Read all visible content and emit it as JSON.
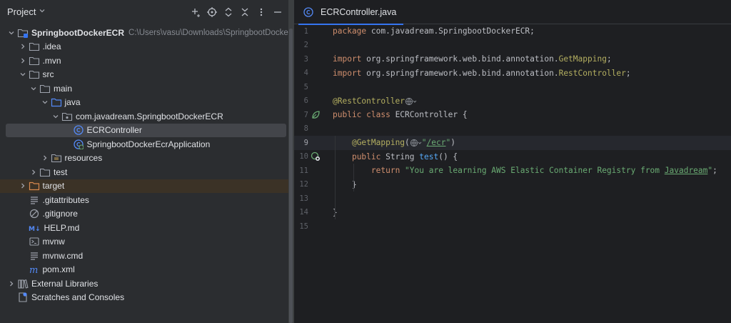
{
  "project_panel": {
    "title": "Project",
    "tools": [
      "add-icon",
      "target-icon",
      "expand-all-icon",
      "collapse-all-icon",
      "more-icon",
      "hide-icon"
    ],
    "tree": [
      {
        "depth": 0,
        "arrow": "down",
        "icon": "module-icon",
        "label": "SpringbootDockerECR",
        "hint": "C:\\Users\\vasu\\Downloads\\SpringbootDockerECR",
        "bold": true
      },
      {
        "depth": 1,
        "arrow": "right",
        "icon": "folder-icon",
        "label": ".idea"
      },
      {
        "depth": 1,
        "arrow": "right",
        "icon": "folder-icon",
        "label": ".mvn"
      },
      {
        "depth": 1,
        "arrow": "down",
        "icon": "folder-icon",
        "label": "src"
      },
      {
        "depth": 2,
        "arrow": "down",
        "icon": "folder-icon",
        "label": "main"
      },
      {
        "depth": 3,
        "arrow": "down",
        "icon": "source-folder-icon",
        "label": "java"
      },
      {
        "depth": 4,
        "arrow": "down",
        "icon": "package-icon",
        "label": "com.javadream.SpringbootDockerECR"
      },
      {
        "depth": 5,
        "arrow": "none",
        "icon": "class-icon",
        "label": "ECRController",
        "selected": true
      },
      {
        "depth": 5,
        "arrow": "none",
        "icon": "spring-class-icon",
        "label": "SpringbootDockerEcrApplication"
      },
      {
        "depth": 3,
        "arrow": "right",
        "icon": "resources-folder-icon",
        "label": "resources"
      },
      {
        "depth": 2,
        "arrow": "right",
        "icon": "folder-icon",
        "label": "test"
      },
      {
        "depth": 1,
        "arrow": "right",
        "icon": "excluded-folder-icon",
        "label": "target",
        "excluded": true
      },
      {
        "depth": 1,
        "arrow": "none",
        "icon": "text-file-icon",
        "label": ".gitattributes"
      },
      {
        "depth": 1,
        "arrow": "none",
        "icon": "ignore-file-icon",
        "label": ".gitignore"
      },
      {
        "depth": 1,
        "arrow": "none",
        "icon": "markdown-icon",
        "label": "HELP.md"
      },
      {
        "depth": 1,
        "arrow": "none",
        "icon": "shell-script-icon",
        "label": "mvnw"
      },
      {
        "depth": 1,
        "arrow": "none",
        "icon": "text-file-icon",
        "label": "mvnw.cmd"
      },
      {
        "depth": 1,
        "arrow": "none",
        "icon": "maven-icon",
        "label": "pom.xml"
      },
      {
        "depth": 0,
        "arrow": "right",
        "icon": "library-icon",
        "label": "External Libraries"
      },
      {
        "depth": 0,
        "arrow": "none",
        "icon": "scratches-icon",
        "label": "Scratches and Consoles"
      }
    ]
  },
  "editor": {
    "tab": {
      "label": "ECRController.java",
      "icon": "class-icon"
    },
    "current_line": 9,
    "lines": [
      {
        "n": "1",
        "tokens": [
          {
            "t": "package ",
            "c": "kw"
          },
          {
            "t": "com.javadream.SpringbootDockerECR;",
            "c": ""
          }
        ]
      },
      {
        "n": "2",
        "tokens": []
      },
      {
        "n": "3",
        "tokens": [
          {
            "t": "import ",
            "c": "kw"
          },
          {
            "t": "org.springframework.web.bind.annotation.",
            "c": ""
          },
          {
            "t": "GetMapping",
            "c": "ann"
          },
          {
            "t": ";",
            "c": ""
          }
        ]
      },
      {
        "n": "4",
        "tokens": [
          {
            "t": "import ",
            "c": "kw"
          },
          {
            "t": "org.springframework.web.bind.annotation.",
            "c": ""
          },
          {
            "t": "RestController",
            "c": "ann"
          },
          {
            "t": ";",
            "c": ""
          }
        ]
      },
      {
        "n": "5",
        "tokens": []
      },
      {
        "n": "6",
        "tokens": [
          {
            "t": "@RestController",
            "c": "ann"
          },
          {
            "t": "",
            "c": "inlay-globe"
          }
        ]
      },
      {
        "n": "7",
        "gutter": "spring-bean-icon",
        "tokens": [
          {
            "t": "public class ",
            "c": "kw"
          },
          {
            "t": "ECRController {",
            "c": ""
          }
        ]
      },
      {
        "n": "8",
        "tokens": []
      },
      {
        "n": "9",
        "tokens": [
          {
            "t": "    ",
            "c": ""
          },
          {
            "t": "@GetMapping",
            "c": "ann"
          },
          {
            "t": "(",
            "c": ""
          },
          {
            "t": "",
            "c": "inlay-globe"
          },
          {
            "t": "\"",
            "c": "str"
          },
          {
            "t": "/ecr",
            "c": "url"
          },
          {
            "t": "\"",
            "c": "str"
          },
          {
            "t": ")",
            "c": ""
          }
        ]
      },
      {
        "n": "10",
        "gutter": "endpoint-icon",
        "tokens": [
          {
            "t": "    ",
            "c": ""
          },
          {
            "t": "public ",
            "c": "kw"
          },
          {
            "t": "String ",
            "c": ""
          },
          {
            "t": "test",
            "c": "fn"
          },
          {
            "t": "() {",
            "c": ""
          }
        ]
      },
      {
        "n": "11",
        "tokens": [
          {
            "t": "        ",
            "c": ""
          },
          {
            "t": "return ",
            "c": "kw"
          },
          {
            "t": "\"You are learning AWS Elastic Container Registry from ",
            "c": "str"
          },
          {
            "t": "Javadream",
            "c": "link"
          },
          {
            "t": "\"",
            "c": "str"
          },
          {
            "t": ";",
            "c": ""
          }
        ]
      },
      {
        "n": "12",
        "tokens": [
          {
            "t": "    }",
            "c": ""
          }
        ]
      },
      {
        "n": "13",
        "tokens": []
      },
      {
        "n": "14",
        "tokens": [
          {
            "t": "}",
            "c": ""
          }
        ]
      },
      {
        "n": "15",
        "tokens": []
      }
    ]
  }
}
